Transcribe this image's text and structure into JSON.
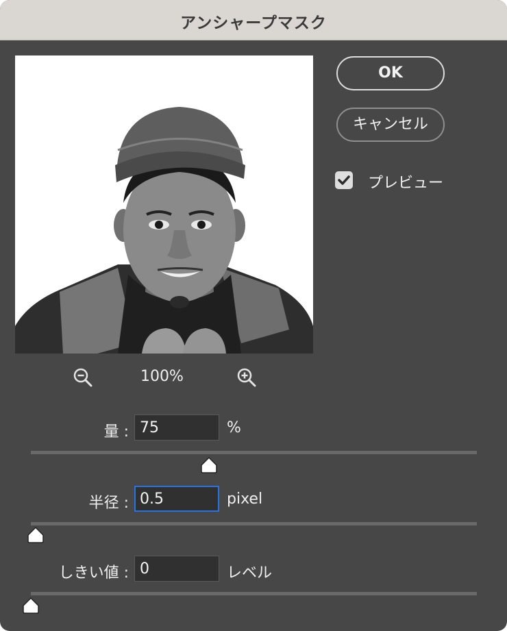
{
  "dialog": {
    "title": "アンシャープマスク"
  },
  "buttons": {
    "ok_label": "OK",
    "cancel_label": "キャンセル"
  },
  "preview_option": {
    "label": "プレビュー",
    "checked": true
  },
  "zoom": {
    "value": "100%",
    "zoom_out_icon": "zoom-out-icon",
    "zoom_in_icon": "zoom-in-icon"
  },
  "amount": {
    "label": "量 :",
    "value": "75",
    "unit": "%",
    "slider_fraction": 0.4
  },
  "radius": {
    "label": "半径 :",
    "value": "0.5",
    "unit": "pixel",
    "slider_fraction": 0.01
  },
  "threshold": {
    "label": "しきい値 :",
    "value": "0",
    "unit": "レベル",
    "slider_fraction": 0.0
  },
  "colors": {
    "dialog_bg": "#474747",
    "titlebar_bg": "#dad6d2",
    "focus_ring": "#2a72e0"
  }
}
